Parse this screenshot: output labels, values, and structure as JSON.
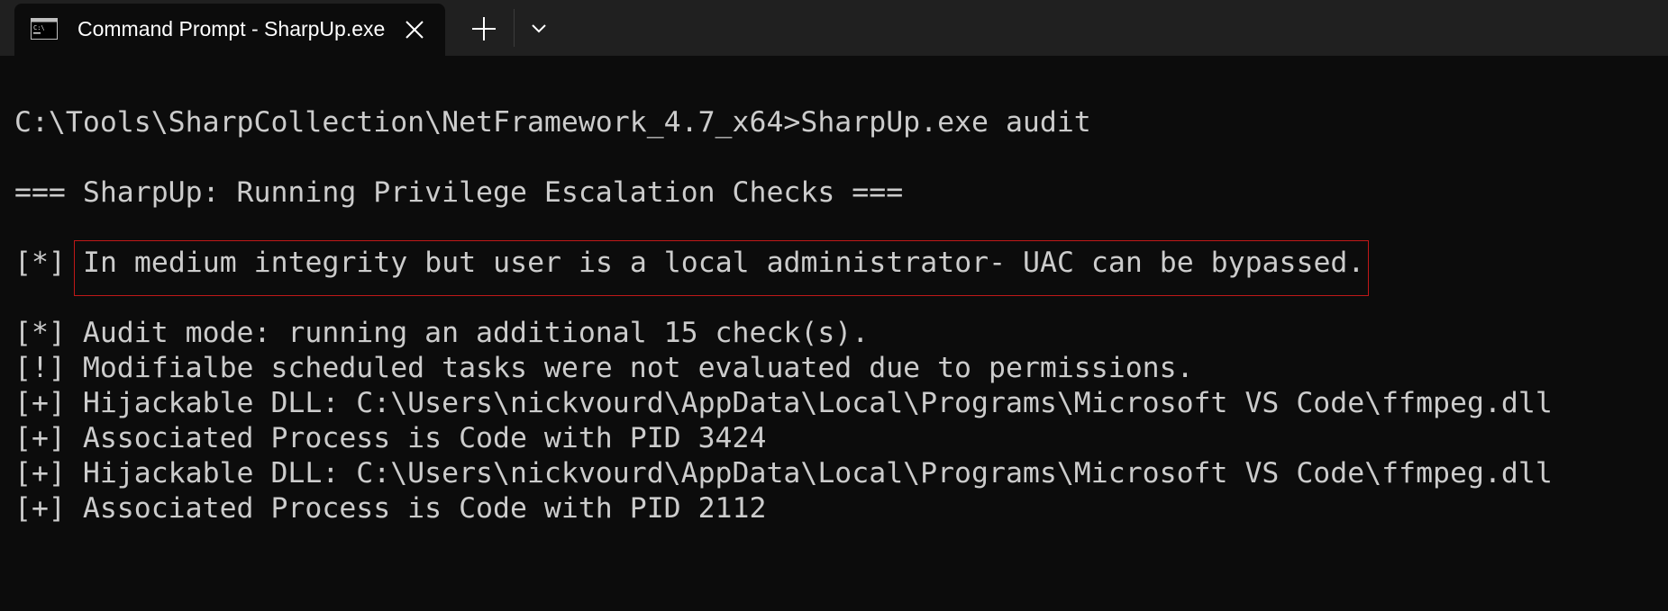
{
  "tab": {
    "title": "Command Prompt - SharpUp.exe",
    "icon": "command-prompt-icon"
  },
  "titlebar": {
    "close_icon": "close-icon",
    "new_tab_icon": "plus-icon",
    "dropdown_icon": "chevron-down-icon"
  },
  "console": {
    "command_line": "C:\\Tools\\SharpCollection\\NetFramework_4.7_x64>SharpUp.exe audit",
    "banner": "=== SharpUp: Running Privilege Escalation Checks ===",
    "uac_prefix": "[*]",
    "uac_message": "In medium integrity but user is a local administrator- UAC can be bypassed.",
    "lines": [
      "[*] Audit mode: running an additional 15 check(s).",
      "[!] Modifialbe scheduled tasks were not evaluated due to permissions.",
      "[+] Hijackable DLL: C:\\Users\\nickvourd\\AppData\\Local\\Programs\\Microsoft VS Code\\ffmpeg.dll",
      "[+] Associated Process is Code with PID 3424",
      "[+] Hijackable DLL: C:\\Users\\nickvourd\\AppData\\Local\\Programs\\Microsoft VS Code\\ffmpeg.dll",
      "[+] Associated Process is Code with PID 2112"
    ]
  },
  "colors": {
    "background": "#0c0c0c",
    "titlebar": "#202020",
    "text": "#cccccc",
    "highlight_border": "#c01818"
  }
}
